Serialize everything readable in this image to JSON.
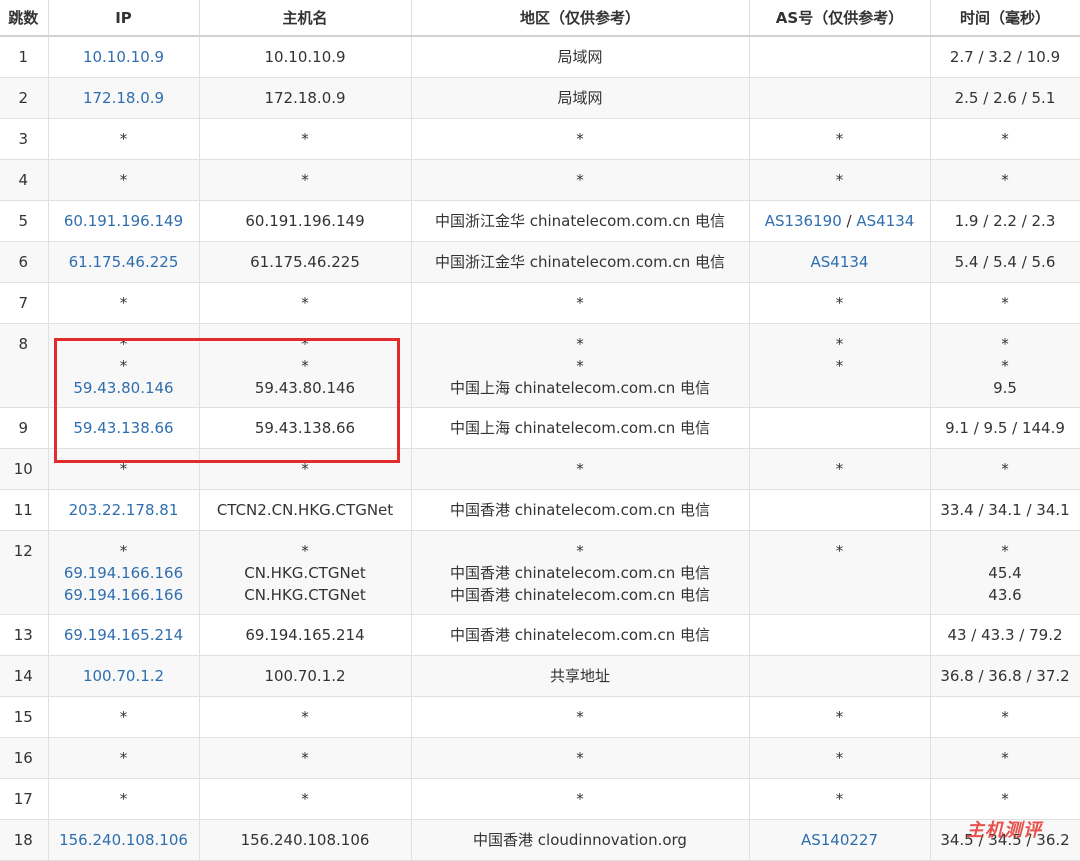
{
  "headers": [
    "跳数",
    "IP",
    "主机名",
    "地区（仅供参考）",
    "AS号（仅供参考）",
    "时间（毫秒）"
  ],
  "rows": [
    {
      "hop": "1",
      "ip": [
        "10.10.10.9"
      ],
      "host": [
        "10.10.10.9"
      ],
      "region": [
        "局域网"
      ],
      "as": [
        []
      ],
      "time": [
        "2.7 / 3.2 / 10.9"
      ]
    },
    {
      "hop": "2",
      "ip": [
        "172.18.0.9"
      ],
      "host": [
        "172.18.0.9"
      ],
      "region": [
        "局域网"
      ],
      "as": [
        []
      ],
      "time": [
        "2.5 / 2.6 / 5.1"
      ]
    },
    {
      "hop": "3",
      "ip": [
        "*"
      ],
      "host": [
        "*"
      ],
      "region": [
        "*"
      ],
      "as": [
        [
          "*"
        ]
      ],
      "time": [
        "*"
      ]
    },
    {
      "hop": "4",
      "ip": [
        "*"
      ],
      "host": [
        "*"
      ],
      "region": [
        "*"
      ],
      "as": [
        [
          "*"
        ]
      ],
      "time": [
        "*"
      ]
    },
    {
      "hop": "5",
      "ip": [
        "60.191.196.149"
      ],
      "host": [
        "60.191.196.149"
      ],
      "region": [
        "中国浙江金华 chinatelecom.com.cn 电信"
      ],
      "as": [
        [
          "AS136190",
          "AS4134"
        ]
      ],
      "time": [
        "1.9 / 2.2 / 2.3"
      ]
    },
    {
      "hop": "6",
      "ip": [
        "61.175.46.225"
      ],
      "host": [
        "61.175.46.225"
      ],
      "region": [
        "中国浙江金华 chinatelecom.com.cn 电信"
      ],
      "as": [
        [
          "AS4134"
        ]
      ],
      "time": [
        "5.4 / 5.4 / 5.6"
      ]
    },
    {
      "hop": "7",
      "ip": [
        "*"
      ],
      "host": [
        "*"
      ],
      "region": [
        "*"
      ],
      "as": [
        [
          "*"
        ]
      ],
      "time": [
        "*"
      ]
    },
    {
      "hop": "8",
      "ip": [
        "*",
        "*",
        "59.43.80.146"
      ],
      "host": [
        "*",
        "*",
        "59.43.80.146"
      ],
      "region": [
        "*",
        "*",
        "中国上海 chinatelecom.com.cn 电信"
      ],
      "as": [
        [
          "*"
        ],
        [
          "*"
        ],
        []
      ],
      "time": [
        "*",
        "*",
        "9.5"
      ]
    },
    {
      "hop": "9",
      "ip": [
        "59.43.138.66"
      ],
      "host": [
        "59.43.138.66"
      ],
      "region": [
        "中国上海 chinatelecom.com.cn 电信"
      ],
      "as": [
        []
      ],
      "time": [
        "9.1 / 9.5 / 144.9"
      ]
    },
    {
      "hop": "10",
      "ip": [
        "*"
      ],
      "host": [
        "*"
      ],
      "region": [
        "*"
      ],
      "as": [
        [
          "*"
        ]
      ],
      "time": [
        "*"
      ]
    },
    {
      "hop": "11",
      "ip": [
        "203.22.178.81"
      ],
      "host": [
        "CTCN2.CN.HKG.CTGNet"
      ],
      "region": [
        "中国香港 chinatelecom.com.cn 电信"
      ],
      "as": [
        []
      ],
      "time": [
        "33.4 / 34.1 / 34.1"
      ]
    },
    {
      "hop": "12",
      "ip": [
        "*",
        "69.194.166.166",
        "69.194.166.166"
      ],
      "host": [
        "*",
        "CN.HKG.CTGNet",
        "CN.HKG.CTGNet"
      ],
      "region": [
        "*",
        "中国香港 chinatelecom.com.cn 电信",
        "中国香港 chinatelecom.com.cn 电信"
      ],
      "as": [
        [
          "*"
        ],
        [],
        []
      ],
      "time": [
        "*",
        "45.4",
        "43.6"
      ]
    },
    {
      "hop": "13",
      "ip": [
        "69.194.165.214"
      ],
      "host": [
        "69.194.165.214"
      ],
      "region": [
        "中国香港 chinatelecom.com.cn 电信"
      ],
      "as": [
        []
      ],
      "time": [
        "43 / 43.3 / 79.2"
      ]
    },
    {
      "hop": "14",
      "ip": [
        "100.70.1.2"
      ],
      "host": [
        "100.70.1.2"
      ],
      "region": [
        "共享地址"
      ],
      "as": [
        []
      ],
      "time": [
        "36.8 / 36.8 / 37.2"
      ]
    },
    {
      "hop": "15",
      "ip": [
        "*"
      ],
      "host": [
        "*"
      ],
      "region": [
        "*"
      ],
      "as": [
        [
          "*"
        ]
      ],
      "time": [
        "*"
      ]
    },
    {
      "hop": "16",
      "ip": [
        "*"
      ],
      "host": [
        "*"
      ],
      "region": [
        "*"
      ],
      "as": [
        [
          "*"
        ]
      ],
      "time": [
        "*"
      ]
    },
    {
      "hop": "17",
      "ip": [
        "*"
      ],
      "host": [
        "*"
      ],
      "region": [
        "*"
      ],
      "as": [
        [
          "*"
        ]
      ],
      "time": [
        "*"
      ]
    },
    {
      "hop": "18",
      "ip": [
        "156.240.108.106"
      ],
      "host": [
        "156.240.108.106"
      ],
      "region": [
        "中国香港 cloudinnovation.org"
      ],
      "as": [
        [
          "AS140227"
        ]
      ],
      "time": [
        "34.5 / 34.5 / 36.2"
      ]
    }
  ],
  "watermark": "主机测评",
  "colors": {
    "link": "#2f6eae",
    "highlight": "#e02c2c",
    "row_alt": "#f8f8f8"
  }
}
